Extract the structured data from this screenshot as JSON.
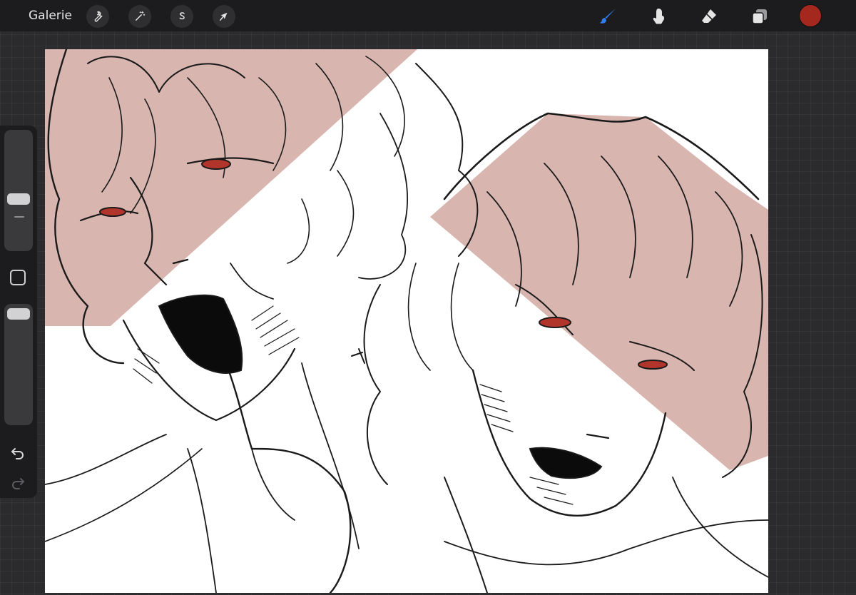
{
  "toolbar": {
    "gallery_label": "Galerie",
    "adjustments": [
      {
        "name": "actions",
        "icon": "wrench-icon"
      },
      {
        "name": "adjustments",
        "icon": "magic-wand-icon"
      },
      {
        "name": "selection",
        "icon": "selection-s-icon"
      },
      {
        "name": "transform",
        "icon": "arrow-cursor-icon"
      }
    ],
    "tools": [
      {
        "name": "brush",
        "icon": "brush-icon",
        "active": true
      },
      {
        "name": "smudge",
        "icon": "smudge-finger-icon",
        "active": false
      },
      {
        "name": "eraser",
        "icon": "eraser-icon",
        "active": false
      },
      {
        "name": "layers",
        "icon": "layers-icon",
        "active": false
      }
    ],
    "current_color": "#a5281f",
    "active_tool_color": "#2f7ff0"
  },
  "sidebar": {
    "brush_size_level": 0.55,
    "opacity_level": 1.0,
    "icons": [
      "modify-square-icon",
      "undo-icon",
      "redo-icon"
    ]
  },
  "canvas": {
    "highlight_color": "#d7b1ab",
    "eye_color": "#b2352b",
    "line_color": "#1a1a1a"
  }
}
